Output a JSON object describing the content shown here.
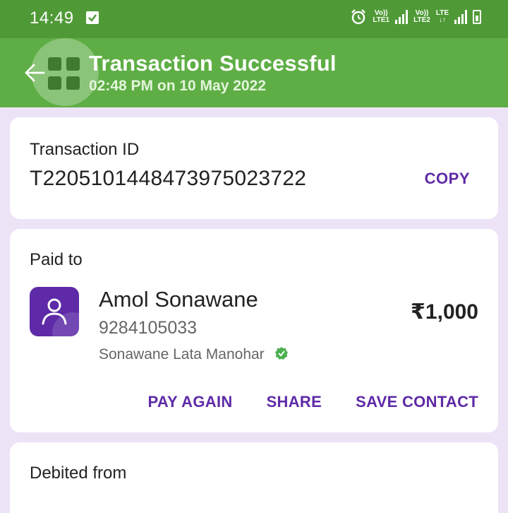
{
  "status_bar": {
    "time": "14:49",
    "icons": [
      "notification-check-icon",
      "alarm-icon",
      "signal-icon",
      "battery-icon"
    ],
    "sim1_label_top": "Vo))",
    "sim1_label_bottom": "LTE1",
    "sim2_label_top": "Vo))",
    "sim2_label_bottom": "LTE2",
    "lte_label": "LTE"
  },
  "app_bar": {
    "title": "Transaction Successful",
    "subtitle": "02:48 PM on 10 May 2022",
    "color": "#5eae45"
  },
  "transaction": {
    "id_label": "Transaction ID",
    "id_value": "T2205101448473975023722",
    "copy_label": "COPY"
  },
  "paid_to": {
    "section_label": "Paid to",
    "name": "Amol Sonawane",
    "phone": "9284105033",
    "bank_name": "Sonawane Lata Manohar",
    "amount": "₹1,000",
    "actions": {
      "pay_again": "PAY AGAIN",
      "share": "SHARE",
      "save_contact": "SAVE CONTACT"
    }
  },
  "debited_from": {
    "section_label": "Debited from"
  },
  "colors": {
    "accent": "#5e2aa7",
    "status_bar": "#4f9a36",
    "background": "#ece4f6",
    "verified": "#4caf50"
  }
}
